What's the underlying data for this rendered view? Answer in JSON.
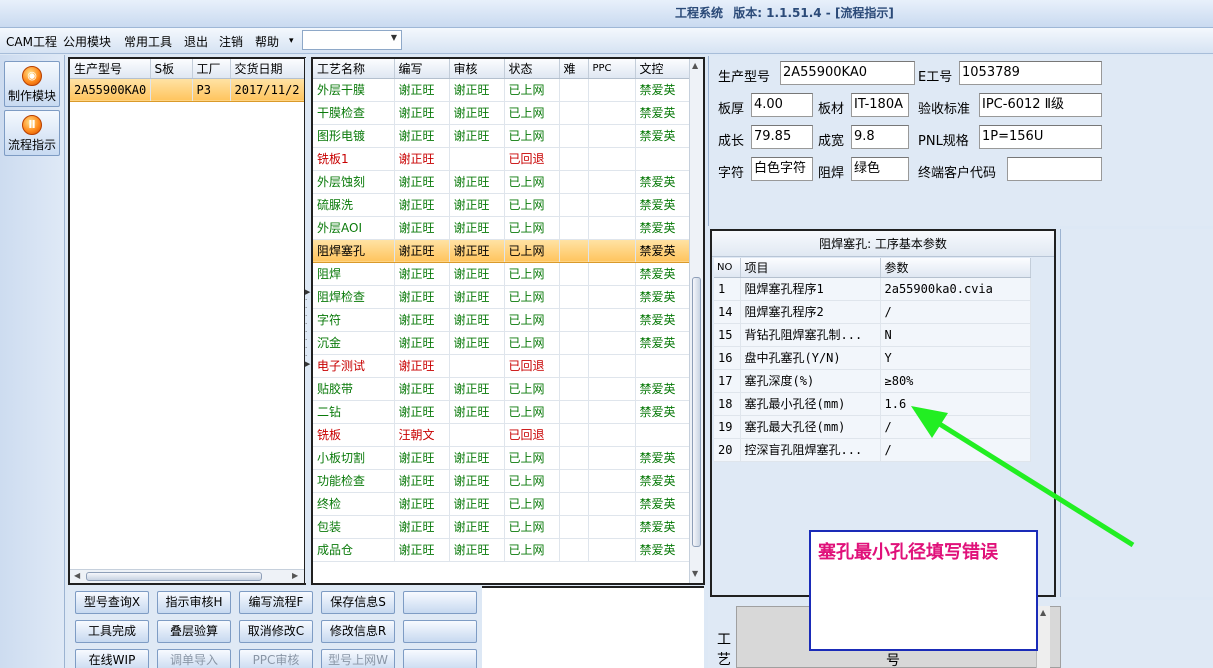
{
  "window": {
    "title": "工程系统",
    "version": "版本: 1.1.51.4 - [流程指示]"
  },
  "menu": {
    "items": [
      "CAM工程",
      "公用模块",
      "常用工具",
      "退出",
      "注销",
      "帮助"
    ],
    "help_dropdown": "▾",
    "combo_value": ""
  },
  "nav": [
    {
      "label": "制作模块",
      "icon": "gear-flame-icon"
    },
    {
      "label": "流程指示",
      "icon": "flow-icon"
    }
  ],
  "product_table": {
    "headers": [
      "生产型号",
      "S板",
      "工厂",
      "交货日期"
    ],
    "rows": [
      [
        "2A55900KA0",
        "",
        "P3",
        "2017/11/2"
      ]
    ]
  },
  "process_table": {
    "headers": [
      "工艺名称",
      "编写",
      "审核",
      "状态",
      "难",
      "PPC",
      "文控"
    ],
    "selected_index": 7,
    "rows": [
      {
        "name": "外层干膜",
        "writer": "谢正旺",
        "reviewer": "谢正旺",
        "status": "已上网",
        "hard": "",
        "ppc": "",
        "doc": "禁爱英",
        "ok": true
      },
      {
        "name": "干膜检查",
        "writer": "谢正旺",
        "reviewer": "谢正旺",
        "status": "已上网",
        "hard": "",
        "ppc": "",
        "doc": "禁爱英",
        "ok": true
      },
      {
        "name": "图形电镀",
        "writer": "谢正旺",
        "reviewer": "谢正旺",
        "status": "已上网",
        "hard": "",
        "ppc": "",
        "doc": "禁爱英",
        "ok": true
      },
      {
        "name": "铣板1",
        "writer": "谢正旺",
        "reviewer": "",
        "status": "已回退",
        "hard": "",
        "ppc": "",
        "doc": "",
        "ok": false
      },
      {
        "name": "外层蚀刻",
        "writer": "谢正旺",
        "reviewer": "谢正旺",
        "status": "已上网",
        "hard": "",
        "ppc": "",
        "doc": "禁爱英",
        "ok": true
      },
      {
        "name": "硫脲洗",
        "writer": "谢正旺",
        "reviewer": "谢正旺",
        "status": "已上网",
        "hard": "",
        "ppc": "",
        "doc": "禁爱英",
        "ok": true
      },
      {
        "name": "外层AOI",
        "writer": "谢正旺",
        "reviewer": "谢正旺",
        "status": "已上网",
        "hard": "",
        "ppc": "",
        "doc": "禁爱英",
        "ok": true
      },
      {
        "name": "阻焊塞孔",
        "writer": "谢正旺",
        "reviewer": "谢正旺",
        "status": "已上网",
        "hard": "",
        "ppc": "",
        "doc": "禁爱英",
        "ok": true
      },
      {
        "name": "阻焊",
        "writer": "谢正旺",
        "reviewer": "谢正旺",
        "status": "已上网",
        "hard": "",
        "ppc": "",
        "doc": "禁爱英",
        "ok": true
      },
      {
        "name": "阻焊检查",
        "writer": "谢正旺",
        "reviewer": "谢正旺",
        "status": "已上网",
        "hard": "",
        "ppc": "",
        "doc": "禁爱英",
        "ok": true
      },
      {
        "name": "字符",
        "writer": "谢正旺",
        "reviewer": "谢正旺",
        "status": "已上网",
        "hard": "",
        "ppc": "",
        "doc": "禁爱英",
        "ok": true
      },
      {
        "name": "沉金",
        "writer": "谢正旺",
        "reviewer": "谢正旺",
        "status": "已上网",
        "hard": "",
        "ppc": "",
        "doc": "禁爱英",
        "ok": true
      },
      {
        "name": "电子测试",
        "writer": "谢正旺",
        "reviewer": "",
        "status": "已回退",
        "hard": "",
        "ppc": "",
        "doc": "",
        "ok": false
      },
      {
        "name": "贴胶带",
        "writer": "谢正旺",
        "reviewer": "谢正旺",
        "status": "已上网",
        "hard": "",
        "ppc": "",
        "doc": "禁爱英",
        "ok": true
      },
      {
        "name": "二钻",
        "writer": "谢正旺",
        "reviewer": "谢正旺",
        "status": "已上网",
        "hard": "",
        "ppc": "",
        "doc": "禁爱英",
        "ok": true
      },
      {
        "name": "铣板",
        "writer": "汪朝文",
        "reviewer": "",
        "status": "已回退",
        "hard": "",
        "ppc": "",
        "doc": "",
        "ok": false
      },
      {
        "name": "小板切割",
        "writer": "谢正旺",
        "reviewer": "谢正旺",
        "status": "已上网",
        "hard": "",
        "ppc": "",
        "doc": "禁爱英",
        "ok": true
      },
      {
        "name": "功能检查",
        "writer": "谢正旺",
        "reviewer": "谢正旺",
        "status": "已上网",
        "hard": "",
        "ppc": "",
        "doc": "禁爱英",
        "ok": true
      },
      {
        "name": "终检",
        "writer": "谢正旺",
        "reviewer": "谢正旺",
        "status": "已上网",
        "hard": "",
        "ppc": "",
        "doc": "禁爱英",
        "ok": true
      },
      {
        "name": "包装",
        "writer": "谢正旺",
        "reviewer": "谢正旺",
        "status": "已上网",
        "hard": "",
        "ppc": "",
        "doc": "禁爱英",
        "ok": true
      },
      {
        "name": "成品仓",
        "writer": "谢正旺",
        "reviewer": "谢正旺",
        "status": "已上网",
        "hard": "",
        "ppc": "",
        "doc": "禁爱英",
        "ok": true
      }
    ]
  },
  "info": {
    "model_label": "生产型号",
    "model": "2A55900KA0",
    "e_label": "E工号",
    "e_no": "1053789",
    "thick_label": "板厚",
    "thick": "4.00",
    "material_label": "板材",
    "material": "IT-180A",
    "standard_label": "验收标准",
    "standard": "IPC-6012 Ⅱ级",
    "length_label": "成长",
    "length": "79.85",
    "width_label": "成宽",
    "width": "9.8",
    "pnl_label": "PNL规格",
    "pnl": "1P=156U",
    "char_label": "字符",
    "char": "白色字符",
    "mask_label": "阻焊",
    "mask": "绿色",
    "customer_label": "终端客户代码",
    "customer": ""
  },
  "params": {
    "caption": "阻焊塞孔: 工序基本参数",
    "headers": [
      "NO",
      "项目",
      "参数"
    ],
    "rows": [
      [
        "1",
        "阻焊塞孔程序1",
        "2a55900ka0.cvia"
      ],
      [
        "14",
        "阻焊塞孔程序2",
        "/"
      ],
      [
        "15",
        "背钻孔阻焊塞孔制...",
        "N"
      ],
      [
        "16",
        "盘中孔塞孔(Y/N)",
        "Y"
      ],
      [
        "17",
        "塞孔深度(%)",
        "≥80%"
      ],
      [
        "18",
        "塞孔最小孔径(mm)",
        "1.6"
      ],
      [
        "19",
        "塞孔最大孔径(mm)",
        "/"
      ],
      [
        "20",
        "控深盲孔阻焊塞孔...",
        "/"
      ]
    ]
  },
  "buttons": [
    {
      "label": "型号查询X",
      "enabled": true
    },
    {
      "label": "指示审核H",
      "enabled": true
    },
    {
      "label": "编写流程F",
      "enabled": true
    },
    {
      "label": "保存信息S",
      "enabled": true
    },
    {
      "label": "",
      "enabled": true
    },
    {
      "label": "工具完成",
      "enabled": true
    },
    {
      "label": "叠层验算",
      "enabled": true
    },
    {
      "label": "取消修改C",
      "enabled": true
    },
    {
      "label": "修改信息R",
      "enabled": true
    },
    {
      "label": "",
      "enabled": true
    },
    {
      "label": "在线WIP",
      "enabled": true
    },
    {
      "label": "调单导入",
      "enabled": false
    },
    {
      "label": "PPC审核",
      "enabled": false
    },
    {
      "label": "型号上网W",
      "enabled": false
    },
    {
      "label": "",
      "enabled": true
    }
  ],
  "bottom_right": {
    "label_vertical": "工\n艺",
    "label_no": "号"
  },
  "annotation": {
    "text": "塞孔最小孔径填写错误",
    "color": "#e0117a",
    "border": "#1a2bb8",
    "arrow_color": "#22ee22"
  },
  "colors": {
    "ok": "#0a7a0a",
    "back": "#c80000",
    "selected": "#ffc45e"
  }
}
